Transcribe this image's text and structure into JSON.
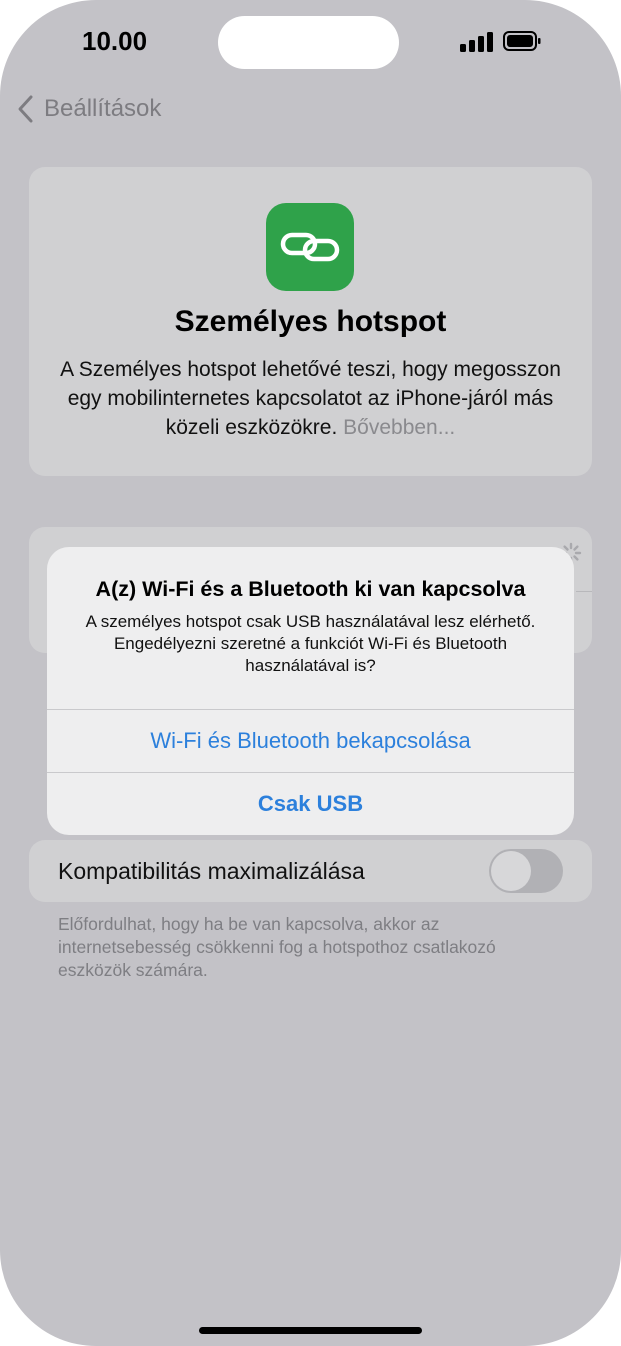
{
  "status_bar": {
    "time": "10.00"
  },
  "nav": {
    "back_label": "Beállítások"
  },
  "hotspot_card": {
    "icon": "link-icon",
    "title": "Személyes hotspot",
    "description": "A Személyes hotspot lehetővé teszi, hogy megosszon egy mobilinternetes kapcsolatot az iPhone-járól más közeli eszközökre.",
    "more_link": "Bővebben..."
  },
  "compatibility": {
    "label": "Kompatibilitás maximalizálása",
    "toggle_on": false,
    "footnote": "Előfordulhat, hogy ha be van kapcsolva, akkor az internetsebesség csökkenni fog a hotspothoz csatlakozó eszközök számára."
  },
  "alert": {
    "title": "A(z) Wi-Fi és a Bluetooth ki van kapcsolva",
    "message": "A személyes hotspot csak USB használatával lesz elérhető. Engedélyezni szeretné a funkciót Wi-Fi és Bluetooth használatával is?",
    "button_primary": "Wi-Fi és Bluetooth bekapcsolása",
    "button_secondary": "Csak USB"
  },
  "colors": {
    "background": "#c3c2c7",
    "card": "#d0d0d2",
    "accent_green": "#2fa24a",
    "link_blue": "#2c80dc"
  }
}
